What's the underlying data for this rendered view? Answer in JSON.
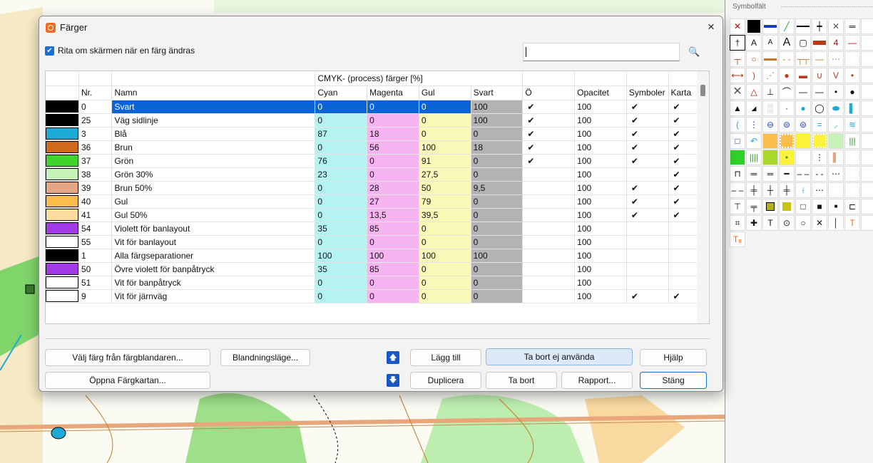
{
  "dialog": {
    "title": "Färger",
    "close_label": "×",
    "redraw_label": "Rita om skärmen när en färg ändras",
    "search_value": ""
  },
  "table": {
    "group_header": "CMYK- (process) färger [%]",
    "columns": [
      "",
      "Nr.",
      "Namn",
      "Cyan",
      "Magenta",
      "Gul",
      "Svart",
      "Ö",
      "Opacitet",
      "Symboler",
      "Karta"
    ],
    "rows": [
      {
        "color": "#000000",
        "nr": "0",
        "name": "Svart",
        "c": "0",
        "m": "0",
        "y": "0",
        "k": "100",
        "o": "✔",
        "opacity": "100",
        "sym": "✔",
        "map": "✔"
      },
      {
        "color": "#000000",
        "nr": "25",
        "name": "Väg sidlinje",
        "c": "0",
        "m": "0",
        "y": "0",
        "k": "100",
        "o": "✔",
        "opacity": "100",
        "sym": "✔",
        "map": "✔"
      },
      {
        "color": "#1eaad6",
        "nr": "3",
        "name": "Blå",
        "c": "87",
        "m": "18",
        "y": "0",
        "k": "0",
        "o": "✔",
        "opacity": "100",
        "sym": "✔",
        "map": "✔"
      },
      {
        "color": "#cf6a1c",
        "nr": "36",
        "name": "Brun",
        "c": "0",
        "m": "56",
        "y": "100",
        "k": "18",
        "o": "✔",
        "opacity": "100",
        "sym": "✔",
        "map": "✔"
      },
      {
        "color": "#3fd42a",
        "nr": "37",
        "name": "Grön",
        "c": "76",
        "m": "0",
        "y": "91",
        "k": "0",
        "o": "✔",
        "opacity": "100",
        "sym": "✔",
        "map": "✔"
      },
      {
        "color": "#c6f2b8",
        "nr": "38",
        "name": "Grön 30%",
        "c": "23",
        "m": "0",
        "y": "27,5",
        "k": "0",
        "o": "",
        "opacity": "100",
        "sym": "",
        "map": "✔"
      },
      {
        "color": "#e4a786",
        "nr": "39",
        "name": "Brun 50%",
        "c": "0",
        "m": "28",
        "y": "50",
        "k": "9,5",
        "o": "",
        "opacity": "100",
        "sym": "✔",
        "map": "✔"
      },
      {
        "color": "#fcbd4c",
        "nr": "40",
        "name": "Gul",
        "c": "0",
        "m": "27",
        "y": "79",
        "k": "0",
        "o": "",
        "opacity": "100",
        "sym": "✔",
        "map": "✔"
      },
      {
        "color": "#fddc9f",
        "nr": "41",
        "name": "Gul 50%",
        "c": "0",
        "m": "13,5",
        "y": "39,5",
        "k": "0",
        "o": "",
        "opacity": "100",
        "sym": "✔",
        "map": "✔"
      },
      {
        "color": "#a23ae8",
        "nr": "54",
        "name": "Violett för banlayout",
        "c": "35",
        "m": "85",
        "y": "0",
        "k": "0",
        "o": "",
        "opacity": "100",
        "sym": "",
        "map": ""
      },
      {
        "color": "#ffffff",
        "nr": "55",
        "name": "Vit för banlayout",
        "c": "0",
        "m": "0",
        "y": "0",
        "k": "0",
        "o": "",
        "opacity": "100",
        "sym": "",
        "map": ""
      },
      {
        "color": "#000000",
        "nr": "1",
        "name": "Alla färgseparationer",
        "c": "100",
        "m": "100",
        "y": "100",
        "k": "100",
        "o": "",
        "opacity": "100",
        "sym": "",
        "map": ""
      },
      {
        "color": "#a23ae8",
        "nr": "50",
        "name": "Övre violett för banpåtryck",
        "c": "35",
        "m": "85",
        "y": "0",
        "k": "0",
        "o": "",
        "opacity": "100",
        "sym": "",
        "map": ""
      },
      {
        "color": "#ffffff",
        "nr": "51",
        "name": "Vit för banpåtryck",
        "c": "0",
        "m": "0",
        "y": "0",
        "k": "0",
        "o": "",
        "opacity": "100",
        "sym": "",
        "map": ""
      },
      {
        "color": "#ffffff",
        "nr": "9",
        "name": "Vit för järnväg",
        "c": "0",
        "m": "0",
        "y": "0",
        "k": "0",
        "o": "",
        "opacity": "100",
        "sym": "✔",
        "map": "✔"
      }
    ]
  },
  "buttons": {
    "pick_mixer": "Välj färg från färgblandaren...",
    "blend_mode": "Blandningsläge...",
    "add": "Lägg till",
    "remove_unused": "Ta bort ej använda",
    "help": "Hjälp",
    "open_chart": "Öppna Färgkartan...",
    "duplicate": "Duplicera",
    "remove": "Ta bort",
    "report": "Rapport...",
    "close": "Stäng"
  },
  "symbol_panel": {
    "title": "Symbolfält"
  },
  "colors": {
    "selection": "#0a64d8",
    "cyan_column": "#b5f3f3",
    "magenta_column": "#f6b4f0",
    "yellow_column": "#fbf9b7",
    "black_column": "#b3b3b3"
  }
}
